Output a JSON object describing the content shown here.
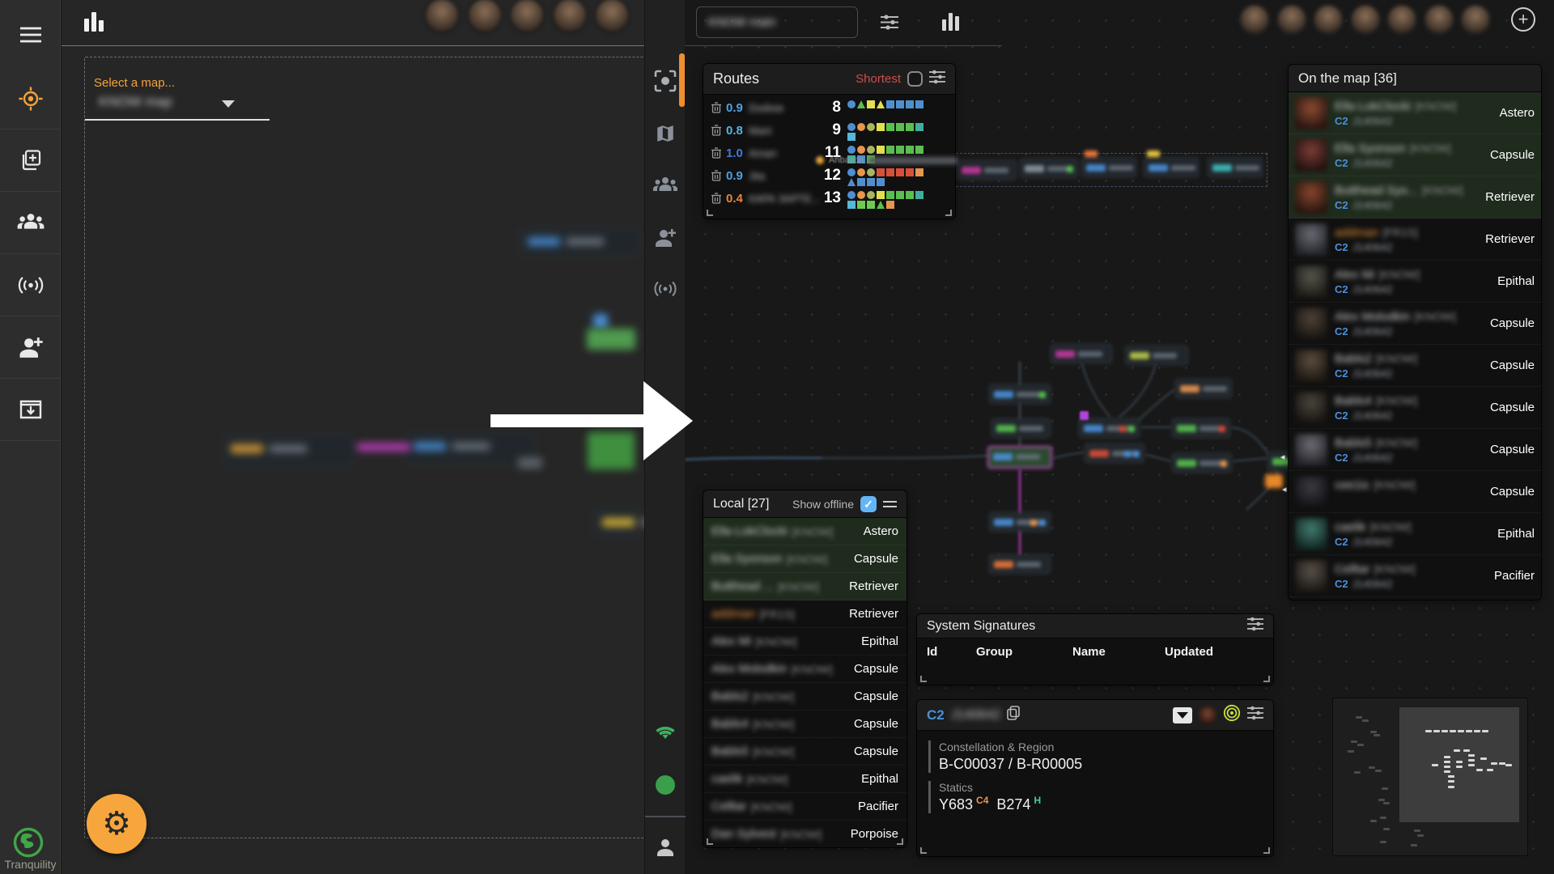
{
  "server": {
    "name": "Tranquility"
  },
  "colors": {
    "accent_orange": "#f5a33c",
    "row_highlight_green": "#1f2b1d",
    "class_blue": "#4a90d9",
    "shortest_red": "#c94f4e",
    "checkbox_blue": "#64b5f6",
    "hostile_orange": "#e8923a"
  },
  "map_select": {
    "label": "Select a map...",
    "value": "KNOW map"
  },
  "toolbar": {
    "map_name": "KNOW main"
  },
  "avatars": {
    "left_count": 5,
    "right_count": 7
  },
  "routes_panel": {
    "title": "Routes",
    "mode_label": "Shortest",
    "tooltip_system": "Ahbazon",
    "routes": [
      {
        "security": "0.9",
        "security_color": "#4fa1e0",
        "destination": "Dodixie",
        "jumps": "8",
        "path": [
          {
            "s": "circle",
            "c": "#4f8fd0"
          },
          {
            "s": "triangle",
            "c": "#5abf4e"
          },
          {
            "s": "square",
            "c": "#e3df4e"
          },
          {
            "s": "triangle",
            "c": "#e3df4e"
          },
          {
            "s": "square",
            "c": "#4f8fd0"
          },
          {
            "s": "square",
            "c": "#4f8fd0"
          },
          {
            "s": "square",
            "c": "#4f8fd0"
          },
          {
            "s": "square",
            "c": "#4f8fd0"
          }
        ]
      },
      {
        "security": "0.8",
        "security_color": "#55b5e2",
        "destination": "Mani",
        "jumps": "9",
        "path": [
          {
            "s": "circle",
            "c": "#4f8fd0"
          },
          {
            "s": "circle",
            "c": "#e8954e"
          },
          {
            "s": "circle",
            "c": "#a9b55f"
          },
          {
            "s": "square",
            "c": "#e3df4e"
          },
          {
            "s": "square",
            "c": "#5abf4e"
          },
          {
            "s": "square",
            "c": "#5abf4e"
          },
          {
            "s": "square",
            "c": "#5abf4e"
          },
          {
            "s": "square",
            "c": "#3fae9e"
          },
          {
            "s": "square",
            "c": "#55b8d8"
          }
        ]
      },
      {
        "security": "1.0",
        "security_color": "#3f7bdc",
        "destination": "Amarr",
        "jumps": "11",
        "path": [
          {
            "s": "circle",
            "c": "#4f8fd0"
          },
          {
            "s": "circle",
            "c": "#e8954e"
          },
          {
            "s": "circle",
            "c": "#a9b55f"
          },
          {
            "s": "square",
            "c": "#e3df4e"
          },
          {
            "s": "square",
            "c": "#5abf4e"
          },
          {
            "s": "square",
            "c": "#5abf4e"
          },
          {
            "s": "square",
            "c": "#5abf4e"
          },
          {
            "s": "square",
            "c": "#5abf4e"
          },
          {
            "s": "square",
            "c": "#3fae9e"
          },
          {
            "s": "square",
            "c": "#4f8fd0"
          },
          {
            "s": "square",
            "c": "#5abf4e"
          }
        ]
      },
      {
        "security": "0.9",
        "security_color": "#4fa1e0",
        "destination": "Jita",
        "jumps": "12",
        "path": [
          {
            "s": "circle",
            "c": "#4f8fd0"
          },
          {
            "s": "circle",
            "c": "#e8954e"
          },
          {
            "s": "circle",
            "c": "#a9b55f"
          },
          {
            "s": "square",
            "c": "#d85038"
          },
          {
            "s": "square",
            "c": "#d85038"
          },
          {
            "s": "square",
            "c": "#d85038"
          },
          {
            "s": "square",
            "c": "#d85038"
          },
          {
            "s": "square",
            "c": "#e8954e"
          },
          {
            "s": "triangle",
            "c": "#4f8fd0"
          },
          {
            "s": "square",
            "c": "#4f8fd0"
          },
          {
            "s": "square",
            "c": "#4f8fd0"
          },
          {
            "s": "square",
            "c": "#4f8fd0"
          }
        ]
      },
      {
        "security": "0.4",
        "security_color": "#e8833a",
        "destination": "КАРА ЗАРТЕ...",
        "jumps": "13",
        "path": [
          {
            "s": "circle",
            "c": "#4f8fd0"
          },
          {
            "s": "circle",
            "c": "#e8954e"
          },
          {
            "s": "circle",
            "c": "#a9b55f"
          },
          {
            "s": "square",
            "c": "#e3df4e"
          },
          {
            "s": "square",
            "c": "#5abf4e"
          },
          {
            "s": "square",
            "c": "#5abf4e"
          },
          {
            "s": "square",
            "c": "#5abf4e"
          },
          {
            "s": "square",
            "c": "#3fae9e"
          },
          {
            "s": "square",
            "c": "#55b8d8"
          },
          {
            "s": "square",
            "c": "#6ecb50"
          },
          {
            "s": "square",
            "c": "#6ecb50"
          },
          {
            "s": "triangle",
            "c": "#5abf4e"
          },
          {
            "s": "square",
            "c": "#e8954e"
          }
        ]
      }
    ]
  },
  "local_panel": {
    "title": "Local [27]",
    "show_offline_label": "Show offline",
    "rows": [
      {
        "name": "Ella LokClocki",
        "corp": "[KNOW]",
        "ship": "Astero",
        "highlight": true
      },
      {
        "name": "Ella Syonson",
        "corp": "[KNOW]",
        "ship": "Capsule",
        "highlight": true
      },
      {
        "name": "Butthead ...",
        "corp": "[KNOW]",
        "ship": "Retriever",
        "highlight": true
      },
      {
        "name": "addman",
        "corp": "[FR1S]",
        "ship": "Retriever",
        "name_color": "#e8923a"
      },
      {
        "name": "Alex Mi",
        "corp": "[KNOW]",
        "ship": "Epithal"
      },
      {
        "name": "Alex Molodkin",
        "corp": "[KNOW]",
        "ship": "Capsule"
      },
      {
        "name": "Babls2",
        "corp": "[KNOW]",
        "ship": "Capsule"
      },
      {
        "name": "Babls4",
        "corp": "[KNOW]",
        "ship": "Capsule"
      },
      {
        "name": "Babls5",
        "corp": "[KNOW]",
        "ship": "Capsule"
      },
      {
        "name": "caelik",
        "corp": "[KNOW]",
        "ship": "Epithal"
      },
      {
        "name": "Celltar",
        "corp": "[KNOW]",
        "ship": "Pacifier"
      },
      {
        "name": "Dan Sylvest",
        "corp": "[KNOW]",
        "ship": "Porpoise"
      }
    ]
  },
  "on_map_panel": {
    "title": "On the map [36]",
    "rows": [
      {
        "name": "Ella LokClocki",
        "corp": "[KNOW]",
        "ship": "Astero",
        "system_class": "C2",
        "system_name": "J140642",
        "show_system": true,
        "highlight": true
      },
      {
        "name": "Ella Syonson",
        "corp": "[KNOW]",
        "ship": "Capsule",
        "system_class": "C2",
        "system_name": "J140642",
        "show_system": true,
        "highlight": true
      },
      {
        "name": "Butthead Syo...",
        "corp": "[KNOW]",
        "ship": "Retriever",
        "system_class": "C2",
        "system_name": "J140642",
        "show_system": true,
        "highlight": true
      },
      {
        "name": "addman",
        "corp": "[FR1S]",
        "ship": "Retriever",
        "system_class": "C2",
        "system_name": "J140642",
        "show_system": true,
        "name_color": "#e8923a"
      },
      {
        "name": "Alex Mi",
        "corp": "[KNOW]",
        "ship": "Epithal",
        "system_class": "C2",
        "system_name": "J140642",
        "show_system": true
      },
      {
        "name": "Alex Molodkin",
        "corp": "[KNOW]",
        "ship": "Capsule",
        "system_class": "C2",
        "system_name": "J140642",
        "show_system": true
      },
      {
        "name": "Babls2",
        "corp": "[KNOW]",
        "ship": "Capsule",
        "system_class": "C2",
        "system_name": "J140642",
        "show_system": true
      },
      {
        "name": "Babls4",
        "corp": "[KNOW]",
        "ship": "Capsule",
        "system_class": "C2",
        "system_name": "J140642",
        "show_system": true
      },
      {
        "name": "Babls5",
        "corp": "[KNOW]",
        "ship": "Capsule",
        "system_class": "C2",
        "system_name": "J140642",
        "show_system": true
      },
      {
        "name": "cee1ic",
        "corp": "[KNOW]",
        "ship": "Capsule",
        "system_class": "C2",
        "system_name": "J140642",
        "show_system": false
      },
      {
        "name": "caelik",
        "corp": "[KNOW]",
        "ship": "Epithal",
        "system_class": "C2",
        "system_name": "J140642",
        "show_system": true
      },
      {
        "name": "Celltar",
        "corp": "[KNOW]",
        "ship": "Pacifier",
        "system_class": "C2",
        "system_name": "J140642",
        "show_system": true
      }
    ]
  },
  "signatures_panel": {
    "title": "System Signatures",
    "columns": [
      "Id",
      "Group",
      "Name",
      "Updated"
    ]
  },
  "system_panel": {
    "class_label": "C2",
    "system_name": "J140642",
    "constellation_label": "Constellation & Region",
    "constellation_value": "B-C00037 / B-R00005",
    "statics_label": "Statics",
    "statics": [
      {
        "code": "Y683",
        "type": "C4",
        "type_color": "#e8954e"
      },
      {
        "code": "B274",
        "type": "H",
        "type_color": "#3fd0a8"
      }
    ]
  }
}
